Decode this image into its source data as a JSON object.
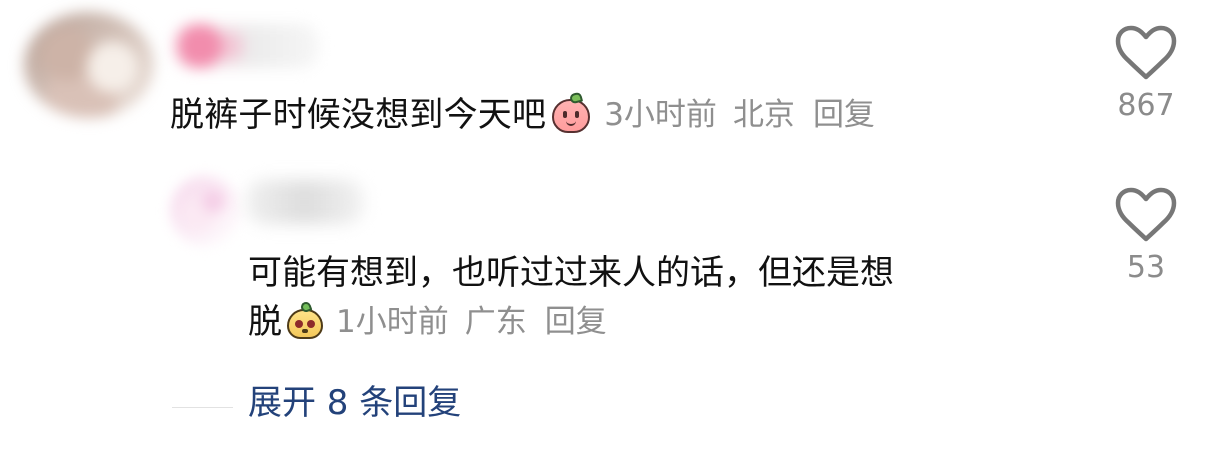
{
  "comment": {
    "text": "脱裤子时候没想到今天吧",
    "time": "3小时前",
    "location": "北京",
    "reply_label": "回复",
    "like_count": "867",
    "emoji_icon": "peach-face-emoji"
  },
  "reply": {
    "text_line_1": "可能有想到，也听过过来人的话，但还是想",
    "text_line_2": "脱",
    "time": "1小时前",
    "location": "广东",
    "reply_label": "回复",
    "like_count": "53",
    "emoji_icon": "dog-face-emoji"
  },
  "expand": {
    "label": "展开 8 条回复"
  },
  "icons": {
    "like": "heart-outline-icon"
  },
  "colors": {
    "primary_text": "#111111",
    "secondary_text": "#8f8f8f",
    "link_text": "#23427a"
  }
}
